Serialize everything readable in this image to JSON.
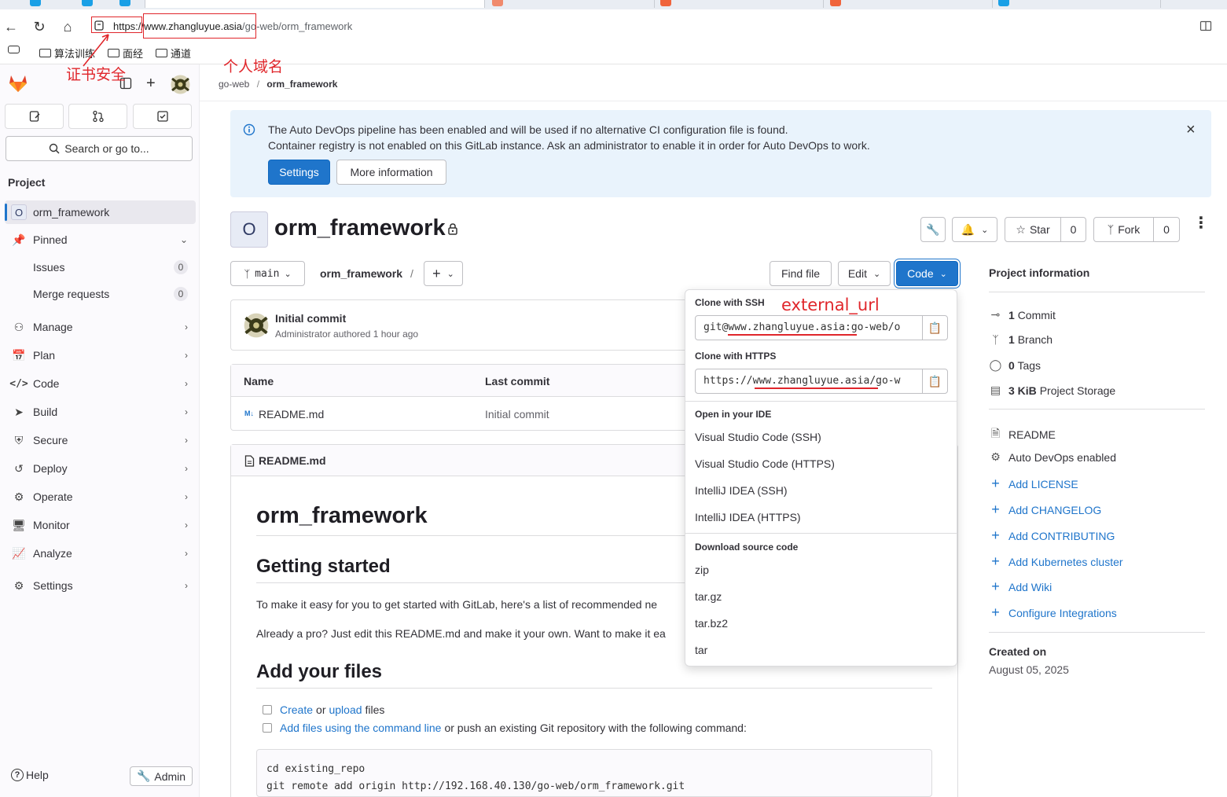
{
  "browser": {
    "url_scheme": "https:",
    "url_host": "//www.zhangluyue.asia",
    "url_path": "/go-web/orm_framework",
    "bookmarks": [
      "算法训练",
      "面经",
      "通道"
    ]
  },
  "annotations": {
    "cert_label": "证书安全",
    "domain_label": "个人域名",
    "external_url_label": "external_url"
  },
  "sidebar": {
    "search_placeholder": "Search or go to...",
    "section_title": "Project",
    "project_letter": "O",
    "project_name": "orm_framework",
    "pinned": "Pinned",
    "issues": "Issues",
    "issues_count": "0",
    "merge_requests": "Merge requests",
    "merge_requests_count": "0",
    "groups": [
      "Manage",
      "Plan",
      "Code",
      "Build",
      "Secure",
      "Deploy",
      "Operate",
      "Monitor",
      "Analyze",
      "Settings"
    ],
    "help": "Help",
    "admin": "Admin"
  },
  "breadcrumb": {
    "group": "go-web",
    "project": "orm_framework"
  },
  "alert": {
    "line1": "The Auto DevOps pipeline has been enabled and will be used if no alternative CI configuration file is found.",
    "line2": "Container registry is not enabled on this GitLab instance. Ask an administrator to enable it in order for Auto DevOps to work.",
    "settings_btn": "Settings",
    "more_btn": "More information"
  },
  "project": {
    "letter": "O",
    "title": "orm_framework",
    "star_label": "Star",
    "star_count": "0",
    "fork_label": "Fork",
    "fork_count": "0"
  },
  "toolbar": {
    "branch": "main",
    "path": "orm_framework",
    "path_sep": "/",
    "find_file": "Find file",
    "edit": "Edit",
    "code": "Code"
  },
  "commit": {
    "title": "Initial commit",
    "meta": "Administrator authored 1 hour ago"
  },
  "files": {
    "col_name": "Name",
    "col_commit": "Last commit",
    "rows": [
      {
        "name": "README.md",
        "commit": "Initial commit"
      }
    ]
  },
  "readme": {
    "header": "README.md",
    "h1": "orm_framework",
    "h2_started": "Getting started",
    "p1": "To make it easy for you to get started with GitLab, here's a list of recommended ne",
    "p2": "Already a pro? Just edit this README.md and make it your own. Want to make it ea",
    "h2_files": "Add your files",
    "check1_create": "Create",
    "check1_or": "or",
    "check1_upload": "upload",
    "check1_files": "files",
    "check2_link": "Add files using the command line",
    "check2_rest": "or push an existing Git repository with the following command:",
    "code_line1": "cd existing_repo",
    "code_line2": "git remote add origin http://192.168.40.130/go-web/orm_framework.git"
  },
  "code_dropdown": {
    "ssh_label": "Clone with SSH",
    "ssh_value": "git@www.zhangluyue.asia:go-web/o",
    "https_label": "Clone with HTTPS",
    "https_value": "https://www.zhangluyue.asia/go-w",
    "ide_label": "Open in your IDE",
    "ide_items": [
      "Visual Studio Code (SSH)",
      "Visual Studio Code (HTTPS)",
      "IntelliJ IDEA (SSH)",
      "IntelliJ IDEA (HTTPS)"
    ],
    "download_label": "Download source code",
    "download_items": [
      "zip",
      "tar.gz",
      "tar.bz2",
      "tar"
    ]
  },
  "project_info": {
    "title": "Project information",
    "commits_count": "1",
    "commits_label": "Commit",
    "branches_count": "1",
    "branches_label": "Branch",
    "tags_count": "0",
    "tags_label": "Tags",
    "storage_size": "3 KiB",
    "storage_label": "Project Storage",
    "readme": "README",
    "autodevops": "Auto DevOps enabled",
    "add_links": [
      "Add LICENSE",
      "Add CHANGELOG",
      "Add CONTRIBUTING",
      "Add Kubernetes cluster",
      "Add Wiki",
      "Configure Integrations"
    ],
    "created_label": "Created on",
    "created_date": "August 05, 2025"
  }
}
